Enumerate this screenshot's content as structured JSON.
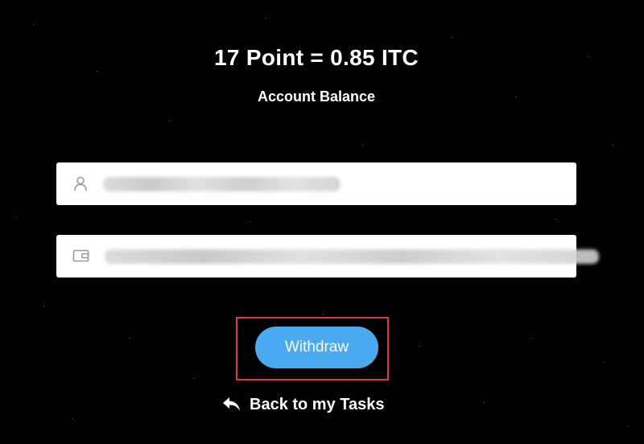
{
  "balance": {
    "headline": "17 Point = 0.85 ITC",
    "label": "Account Balance"
  },
  "form": {
    "username": {
      "icon": "user-icon",
      "value": ""
    },
    "wallet": {
      "icon": "wallet-icon",
      "value": ""
    }
  },
  "actions": {
    "withdraw_label": "Withdraw",
    "back_label": "Back to my Tasks",
    "back_icon": "reply-arrow-icon"
  },
  "colors": {
    "background": "#000000",
    "button": "#4aaaf0",
    "highlight": "#e0393b"
  }
}
